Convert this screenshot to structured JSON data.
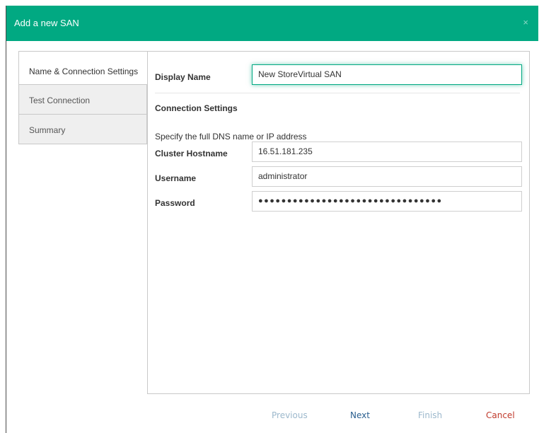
{
  "dialog": {
    "title": "Add a new SAN",
    "close_glyph": "×"
  },
  "nav": {
    "items": [
      {
        "label": "Name & Connection Settings",
        "active": true
      },
      {
        "label": "Test Connection",
        "active": false
      },
      {
        "label": "Summary",
        "active": false
      }
    ]
  },
  "form": {
    "display_name_label": "Display Name",
    "display_name_value": "New StoreVirtual SAN",
    "connection_heading": "Connection Settings",
    "hint": "Specify the full DNS name or IP address",
    "cluster_hostname_label": "Cluster Hostname",
    "cluster_hostname_value": "16.51.181.235",
    "username_label": "Username",
    "username_value": "administrator",
    "password_label": "Password",
    "password_value": "●●●●●●●●●●●●●●●●●●●●●●●●●●●●●●●●"
  },
  "footer": {
    "previous_label": "Previous",
    "next_label": "Next",
    "finish_label": "Finish",
    "cancel_label": "Cancel"
  },
  "colors": {
    "titlebar": "#01a982",
    "next": "#2a5f8f",
    "disabled": "#9cb8cc",
    "cancel": "#c0392b"
  }
}
